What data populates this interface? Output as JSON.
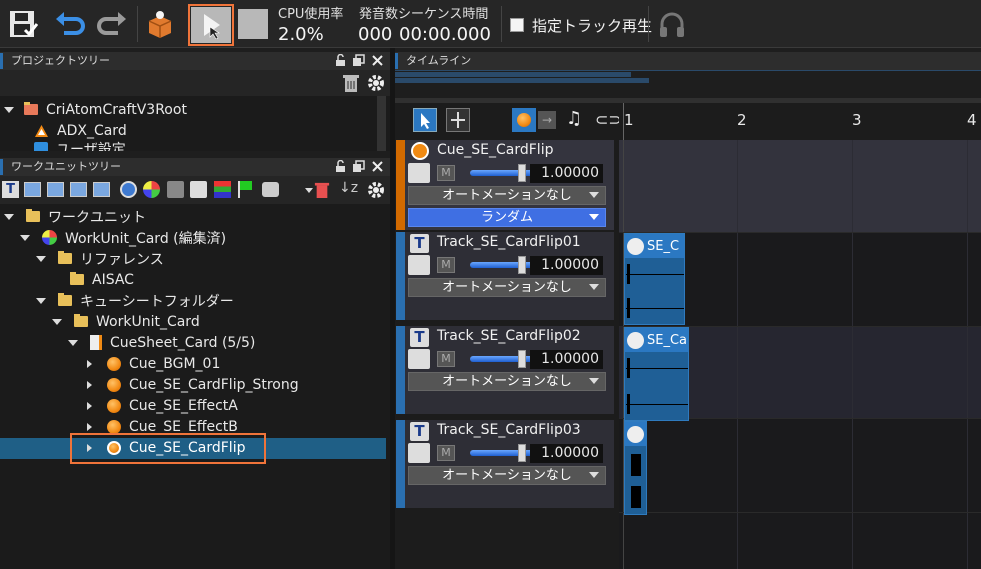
{
  "toolbar": {
    "cpu_label": "CPU使用率",
    "cpu_value": "2.0%",
    "voices_label": "発音数",
    "sequence_label": "シーケンス時間",
    "voices_value": "000",
    "sequence_value": "00:00.000",
    "specified_track_label": "指定トラック再生",
    "specified_track_checked": false
  },
  "project_tree": {
    "title": "プロジェクトツリー",
    "items": [
      {
        "label": "CriAtomCraftV3Root"
      },
      {
        "label": "ADX_Card"
      },
      {
        "label": "ユーザ設定"
      }
    ]
  },
  "workunit_tree": {
    "title": "ワークユニットツリー",
    "items": [
      {
        "label": "ワークユニット",
        "level": 0,
        "icon": "folder-icon",
        "expanded": true
      },
      {
        "label": "WorkUnit_Card (編集済)",
        "level": 1,
        "icon": "workunit-icon",
        "expanded": true
      },
      {
        "label": "リファレンス",
        "level": 2,
        "icon": "folder-icon",
        "expanded": true
      },
      {
        "label": "AISAC",
        "level": 3,
        "icon": "folder-icon",
        "expanded": null
      },
      {
        "label": "キューシートフォルダー",
        "level": 2,
        "icon": "folder-icon",
        "expanded": true
      },
      {
        "label": "WorkUnit_Card",
        "level": 3,
        "icon": "folder-icon",
        "expanded": true
      },
      {
        "label": "CueSheet_Card (5/5)",
        "level": 4,
        "icon": "cuesheet-icon",
        "expanded": true
      },
      {
        "label": "Cue_BGM_01",
        "level": 5,
        "icon": "cue-icon",
        "expanded": false
      },
      {
        "label": "Cue_SE_CardFlip_Strong",
        "level": 5,
        "icon": "cue-icon",
        "expanded": false
      },
      {
        "label": "Cue_SE_EffectA",
        "level": 5,
        "icon": "cue-icon",
        "expanded": false
      },
      {
        "label": "Cue_SE_EffectB",
        "level": 5,
        "icon": "cue-icon",
        "expanded": false
      },
      {
        "label": "Cue_SE_CardFlip",
        "level": 5,
        "icon": "cue-random-icon",
        "expanded": false,
        "selected": true
      }
    ]
  },
  "timeline": {
    "title": "タイムライン",
    "ruler": [
      "1",
      "2",
      "3",
      "4"
    ],
    "cue": {
      "name": "Cue_SE_CardFlip",
      "mute_label": "M",
      "volume": "1.00000",
      "automation": "オートメーションなし",
      "sequence_type": "ランダム"
    },
    "tracks": [
      {
        "name": "Track_SE_CardFlip01",
        "mute_label": "M",
        "volume": "1.00000",
        "automation": "オートメーションなし",
        "clip_label": "SE_C"
      },
      {
        "name": "Track_SE_CardFlip02",
        "mute_label": "M",
        "volume": "1.00000",
        "automation": "オートメーションなし",
        "clip_label": "SE_Ca"
      },
      {
        "name": "Track_SE_CardFlip03",
        "mute_label": "M",
        "volume": "1.00000",
        "automation": "オートメーションなし",
        "clip_label": ""
      }
    ]
  },
  "colors": {
    "accent_blue": "#2b78c2",
    "highlight_orange": "#f0743a",
    "selection": "#1f5f86",
    "random_bar": "#3f6fe3"
  }
}
